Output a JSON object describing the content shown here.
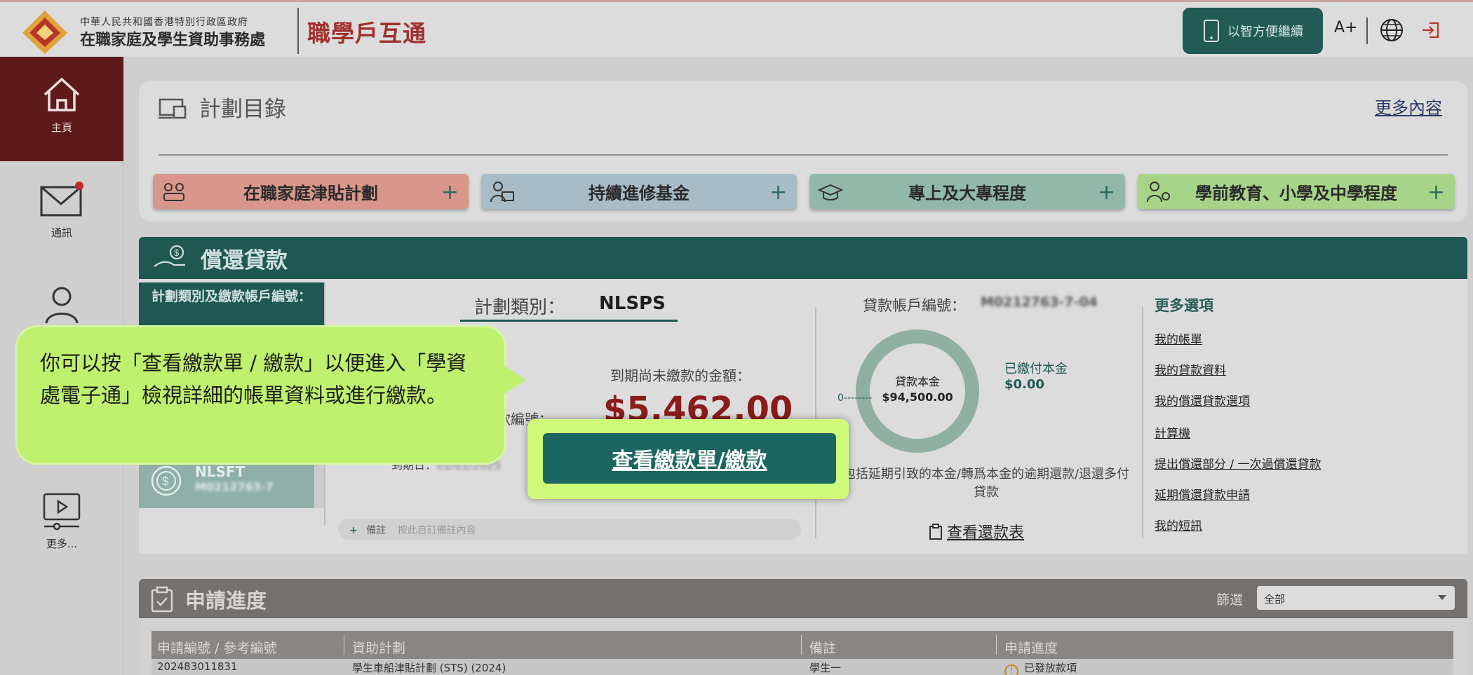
{
  "header": {
    "gov_line": "中華人民共和國香港特別行政區政府",
    "office_name": "在職家庭及學生資助事務處",
    "app_title": "職學戶互通",
    "smart_id_button": "以智方便繼續",
    "font_size_button": "A+"
  },
  "sidebar": {
    "items": [
      {
        "label": "主頁",
        "icon": "home-icon"
      },
      {
        "label": "通訊",
        "icon": "mail-icon"
      },
      {
        "label": "",
        "icon": "user-icon"
      },
      {
        "label": "更多...",
        "icon": "video-icon"
      }
    ]
  },
  "plans": {
    "title": "計劃目錄",
    "more_link": "更多內容",
    "buttons": [
      {
        "label": "在職家庭津貼計劃",
        "color": "#d9968a"
      },
      {
        "label": "持續進修基金",
        "color": "#a7bcc6"
      },
      {
        "label": "專上及大專程度",
        "color": "#92b8aa"
      },
      {
        "label": "學前教育、小學及中學程度",
        "color": "#a6d489"
      }
    ]
  },
  "repayment": {
    "title": "償還貸款",
    "account_list_header": "計劃類別及繳款帳戶編號：",
    "second_account_type": "NLSFT",
    "second_account_no": "M0212763-7",
    "scheme_label": "計劃類別：",
    "scheme_value": "NLSPS",
    "due_label": "到期尚未繳款的金額：",
    "due_amount": "$5,462.00",
    "acct_no_partial": "款編號：",
    "due_date_label": "到期日：",
    "due_date_value": "01/01/2025",
    "note_label": "備註",
    "note_placeholder": "按此自訂備註內容",
    "loan_acct_label": "貸款帳戶編號：",
    "loan_acct_value": "M0212763-7-04",
    "donut_label": "貸款本金",
    "donut_value": "$94,500.00",
    "donut_zero": "0",
    "paid_label": "已繳付本金",
    "paid_value": "$0.00",
    "footnote": "包括延期引致的本金/轉爲本金的逾期還款/退還多付貸款",
    "schedule_link": "查看還款表",
    "more_options_title": "更多選項",
    "more_links": [
      "我的帳單",
      "我的貸款資料",
      "我的償還貸款選項",
      "計算機",
      "提出償還部分 / 一次過償還貸款",
      "延期償還貸款申請",
      "我的短訊"
    ]
  },
  "tutorial": {
    "bubble_text": "你可以按「查看繳款單 / 繳款」以便進入「學資處電子通」檢視詳細的帳單資料或進行繳款。",
    "cta_button": "查看繳款單/繳款"
  },
  "progress": {
    "title": "申請進度",
    "filter_label": "篩選",
    "filter_value": "全部",
    "columns": [
      "申請編號 / 參考編號",
      "資助計劃",
      "備註",
      "申請進度"
    ],
    "rows": [
      {
        "ref": "202483011831",
        "scheme": "學生車船津貼計劃 (STS) (2024)",
        "remark": "學生一",
        "status": "已發放款項"
      }
    ]
  }
}
